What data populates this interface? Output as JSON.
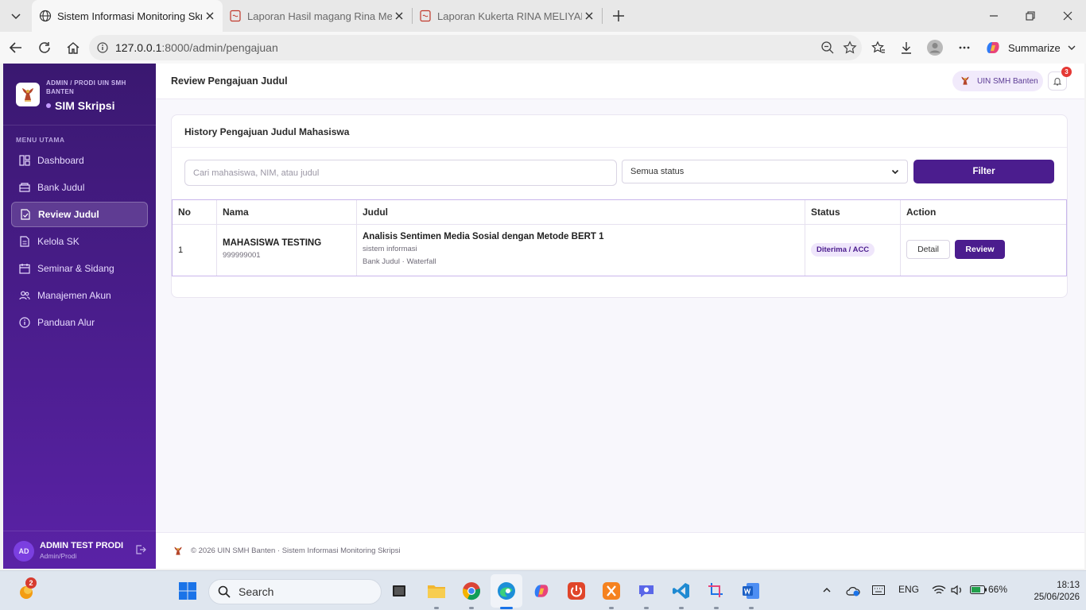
{
  "browser": {
    "tabs": [
      {
        "label": "Sistem Informasi Monitoring Skrip",
        "active": true
      },
      {
        "label": "Laporan Hasil magang Rina Meliya",
        "active": false
      },
      {
        "label": "Laporan Kukerta RINA MELIYANA",
        "active": false
      }
    ],
    "url_host": "127.0.0.1",
    "url_path": ":8000/admin/pengajuan",
    "summarize_label": "Summarize"
  },
  "sidebar": {
    "brand_sub": "ADMIN / PRODI UIN SMH BANTEN",
    "brand_title": "SIM Skripsi",
    "menu_heading": "MENU UTAMA",
    "items": [
      {
        "label": "Dashboard",
        "icon": "dashboard-icon"
      },
      {
        "label": "Bank Judul",
        "icon": "archive-icon"
      },
      {
        "label": "Review Judul",
        "icon": "review-doc-icon",
        "active": true
      },
      {
        "label": "Kelola SK",
        "icon": "document-icon"
      },
      {
        "label": "Seminar & Sidang",
        "icon": "calendar-icon"
      },
      {
        "label": "Manajemen Akun",
        "icon": "users-icon"
      },
      {
        "label": "Panduan Alur",
        "icon": "info-icon"
      }
    ],
    "user": {
      "initials": "AD",
      "name": "ADMIN TEST PRODI",
      "role": "Admin/Prodi"
    }
  },
  "header": {
    "title": "Review Pengajuan Judul",
    "campus_label": "UIN SMH Banten",
    "notification_count": "3"
  },
  "card": {
    "title": "History Pengajuan Judul Mahasiswa",
    "search_placeholder": "Cari mahasiswa, NIM, atau judul",
    "status_selected": "Semua status",
    "filter_label": "Filter",
    "columns": [
      "No",
      "Nama",
      "Judul",
      "Status",
      "Action"
    ],
    "rows": [
      {
        "no": "1",
        "nama": "MAHASISWA TESTING",
        "nim": "999999001",
        "judul": "Analisis Sentimen Media Sosial dengan Metode BERT 1",
        "bidang": "sistem informasi",
        "meta": "Bank Judul · Waterfall",
        "status": "Diterima / ACC",
        "detail_label": "Detail",
        "review_label": "Review"
      }
    ]
  },
  "footer": {
    "text": "© 2026 UIN SMH Banten · Sistem Informasi Monitoring Skripsi"
  },
  "taskbar": {
    "weather_badge": "2",
    "search_label": "Search",
    "lang": "ENG",
    "battery": "66%",
    "time": "18:13",
    "date": "25/06/2026"
  },
  "colors": {
    "primary": "#4b1d8e",
    "sidebar_top": "#3a1870",
    "sidebar_bottom": "#5a22a6",
    "badge_red": "#e53935"
  }
}
